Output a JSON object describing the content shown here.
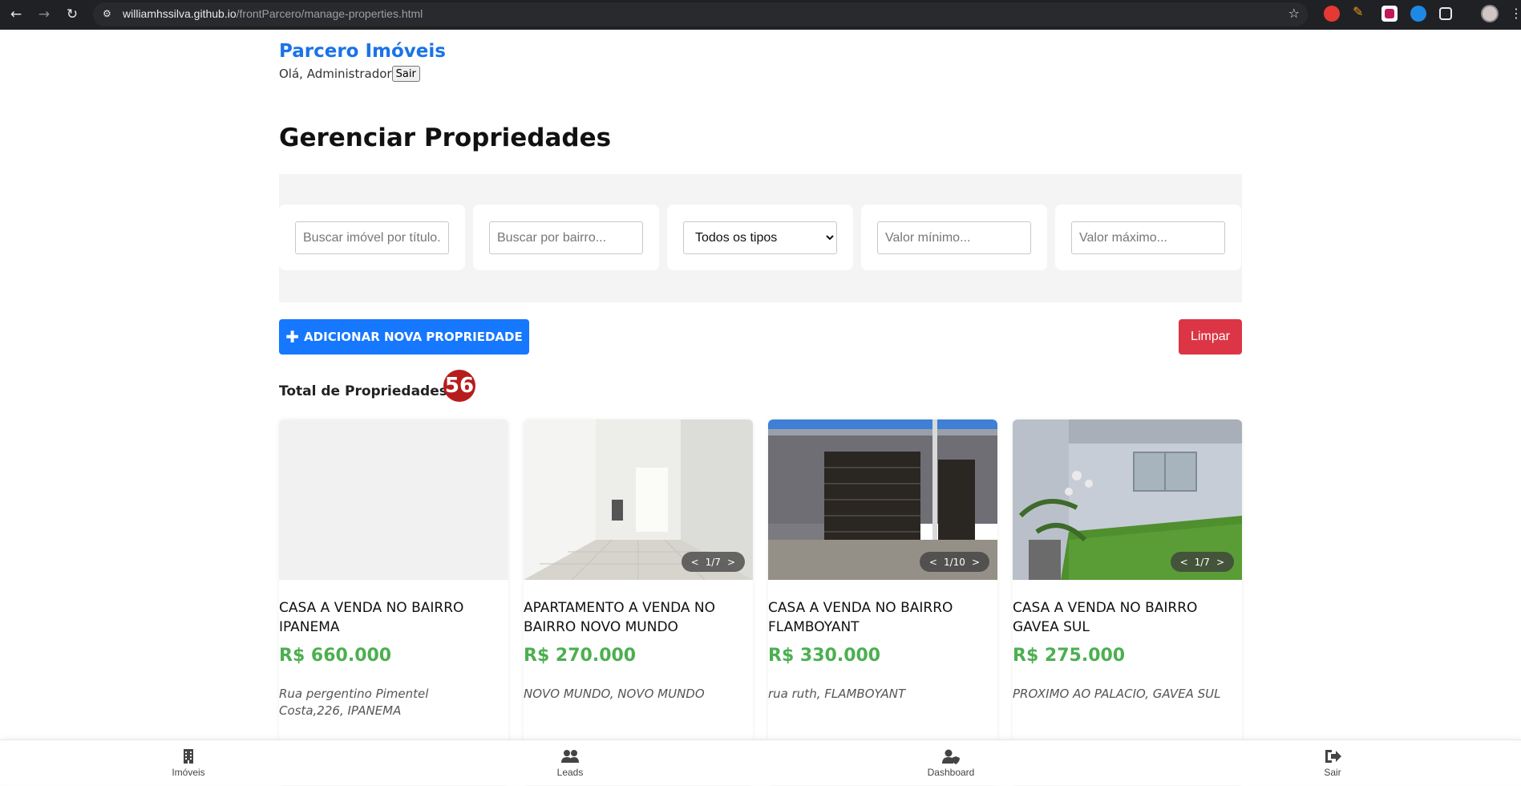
{
  "browser": {
    "url_host": "williamhssilva.github.io",
    "url_path": "/frontParcero/manage-properties.html"
  },
  "header": {
    "brand": "Parcero Imóveis",
    "greeting": "Olá, Administrador",
    "logout_label": "Sair"
  },
  "main": {
    "title": "Gerenciar Propriedades",
    "filters": {
      "search_title_placeholder": "Buscar imóvel por título...",
      "search_neighborhood_placeholder": "Buscar por bairro...",
      "type_selected": "Todos os tipos",
      "min_value_placeholder": "Valor mínimo...",
      "max_value_placeholder": "Valor máximo..."
    },
    "add_button_label": "ADICIONAR NOVA PROPRIEDADE",
    "clear_button_label": "Limpar",
    "total_label": "Total de Propriedades:",
    "total_count": "56"
  },
  "properties": [
    {
      "title": "CASA A VENDA NO BAIRRO IPANEMA",
      "price": "R$ 660.000",
      "address": "Rua pergentino Pimentel Costa,226, IPANEMA",
      "pager": "",
      "image": "empty"
    },
    {
      "title": "APARTAMENTO A VENDA NO BAIRRO NOVO MUNDO",
      "price": "R$ 270.000",
      "address": "NOVO MUNDO, NOVO MUNDO",
      "pager": "1/7",
      "image": "apartment"
    },
    {
      "title": "CASA A VENDA NO BAIRRO FLAMBOYANT",
      "price": "R$ 330.000",
      "address": "rua ruth, FLAMBOYANT",
      "pager": "1/10",
      "image": "gate"
    },
    {
      "title": "CASA A VENDA NO BAIRRO GAVEA SUL",
      "price": "R$ 275.000",
      "address": "PROXIMO AO PALACIO, GAVEA SUL",
      "pager": "1/7",
      "image": "house"
    }
  ],
  "pager_prev": "<",
  "pager_next": ">",
  "bottom_nav": [
    {
      "label": "Imóveis",
      "icon": "building-icon"
    },
    {
      "label": "Leads",
      "icon": "users-icon"
    },
    {
      "label": "Dashboard",
      "icon": "user-shield-icon"
    },
    {
      "label": "Sair",
      "icon": "sign-out-icon"
    }
  ],
  "colors": {
    "brand": "#1a73e8",
    "primary_button": "#1677ff",
    "danger_button": "#dc3545",
    "badge": "#b71c1c",
    "price": "#4caf50"
  }
}
